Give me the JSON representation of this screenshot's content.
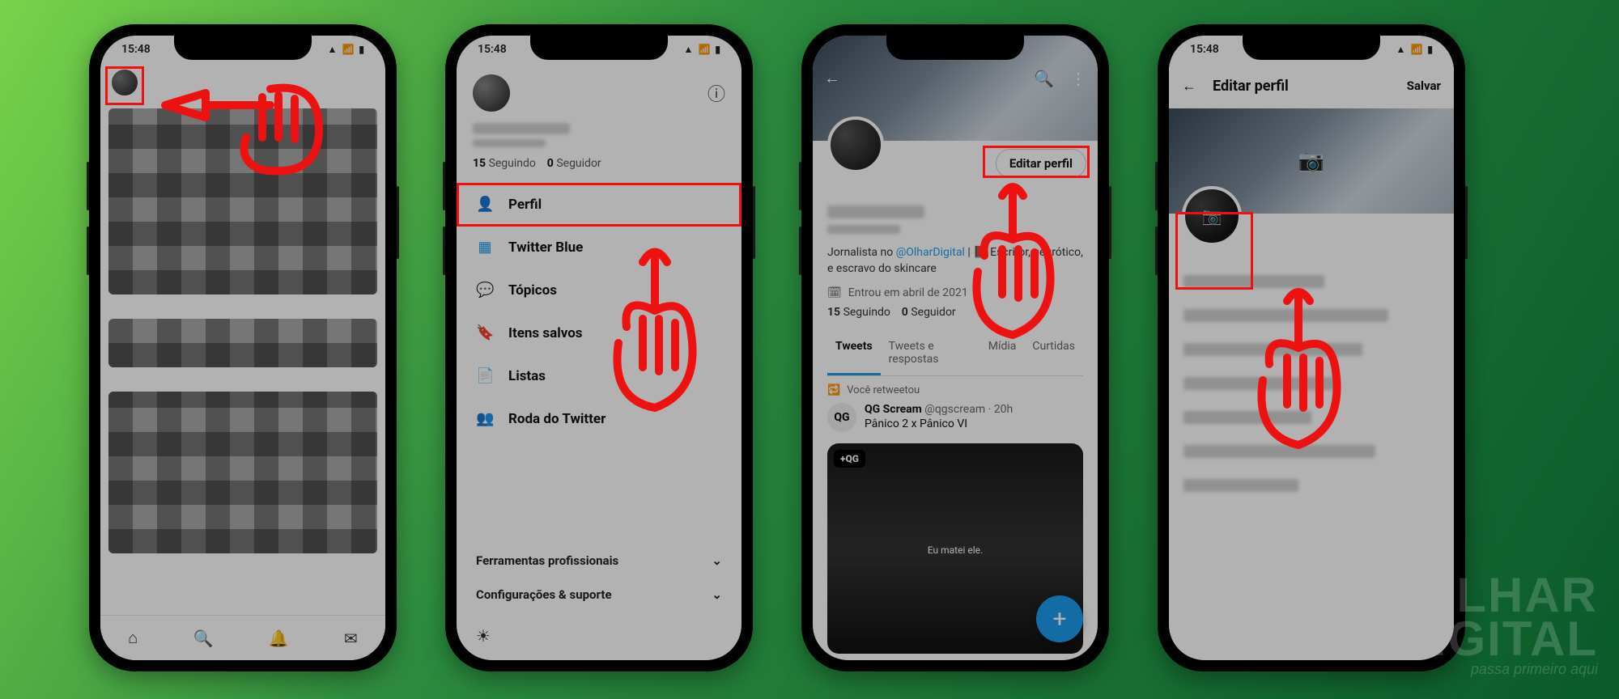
{
  "status_time": "15:48",
  "screen1": {
    "nav": {
      "home": "⌂",
      "search": "🔍",
      "bell": "🔔",
      "mail": "✉"
    }
  },
  "screen2": {
    "following_count": "15",
    "following_label": "Seguindo",
    "followers_count": "0",
    "followers_label": "Seguidor",
    "menu": {
      "perfil": "Perfil",
      "twitter_blue": "Twitter Blue",
      "topicos": "Tópicos",
      "itens_salvos": "Itens salvos",
      "listas": "Listas",
      "roda": "Roda do Twitter"
    },
    "footer": {
      "pro": "Ferramentas profissionais",
      "config": "Configurações & suporte"
    }
  },
  "screen3": {
    "edit_label": "Editar perfil",
    "bio_prefix": "Jornalista no ",
    "bio_handle": "@OlharDigital",
    "bio_rest": " | 📕 Escritor, neurótico, e escravo do skincare",
    "joined": "Entrou em abril de 2021",
    "following_count": "15",
    "following_label": "Seguindo",
    "followers_count": "0",
    "followers_label": "Seguidor",
    "tabs": {
      "tweets": "Tweets",
      "replies": "Tweets e respostas",
      "media": "Mídia",
      "likes": "Curtidas"
    },
    "rt_label": "Você retweetou",
    "tweet_author": "QG Scream",
    "tweet_handle": "@qgscream",
    "tweet_time": "20h",
    "tweet_text": "Pânico 2 x Pânico VI",
    "media_badge": "+QG",
    "media_caption": "Eu matei ele."
  },
  "screen4": {
    "title": "Editar perfil",
    "save": "Salvar"
  },
  "watermark_line1": "LHAR",
  "watermark_line2": "DIGITAL",
  "watermark_tag": "passa primeiro aqui"
}
